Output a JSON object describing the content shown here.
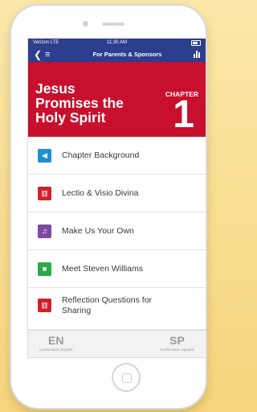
{
  "status": {
    "carrier": "Verizon  LTE",
    "time": "11:30 AM"
  },
  "navbar": {
    "title": "For Parents & Sponsors",
    "back_icon": "chevron-left-icon",
    "menu_icon": "hamburger-icon",
    "stats_icon": "bar-chart-icon"
  },
  "chapter": {
    "title": "Jesus Promises the Holy Spirit",
    "label": "CHAPTER",
    "number": "1",
    "color": "#c8102e"
  },
  "items": [
    {
      "label": "Chapter Background",
      "icon": "speaker-icon",
      "color": "#1e8fd0"
    },
    {
      "label": "Lectio & Visio Divina",
      "icon": "book-icon",
      "color": "#d0202e"
    },
    {
      "label": "Make Us Your Own",
      "icon": "music-note-icon",
      "color": "#7c4a9e"
    },
    {
      "label": "Meet Steven Williams",
      "icon": "video-camera-icon",
      "color": "#2aa84a"
    },
    {
      "label": "Reflection Questions for Sharing",
      "icon": "book-icon",
      "color": "#d0202e"
    }
  ],
  "languages": [
    {
      "code": "EN",
      "label": "Confirmation English"
    },
    {
      "code": "SP",
      "label": "Confirmation Spanish"
    }
  ]
}
